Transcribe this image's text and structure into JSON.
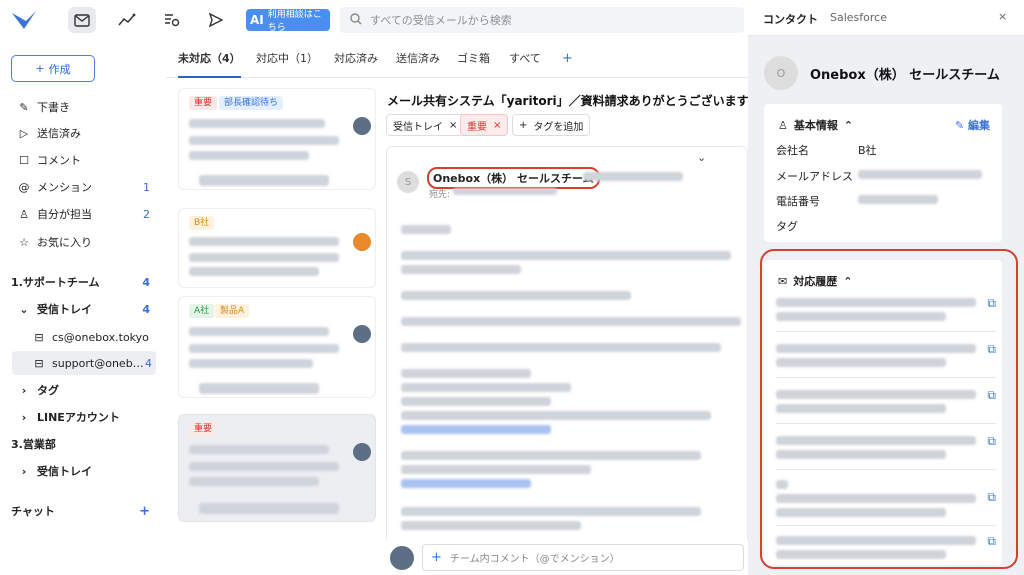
{
  "header": {
    "ai_badge": "AI",
    "ai_label": "利用相談はこちら",
    "search_placeholder": "すべての受信メールから検索"
  },
  "sidebar": {
    "compose_label": "作成",
    "items": [
      {
        "label": "下書き",
        "icon": "pencil-icon"
      },
      {
        "label": "送信済み",
        "icon": "send-icon"
      },
      {
        "label": "コメント",
        "icon": "comment-icon"
      },
      {
        "label": "メンション",
        "icon": "at-icon",
        "count": "1"
      },
      {
        "label": "自分が担当",
        "icon": "person-icon",
        "count": "2"
      },
      {
        "label": "お気に入り",
        "icon": "star-icon"
      }
    ],
    "team1": {
      "label": "1.サポートチーム",
      "count": "4"
    },
    "inbox": {
      "label": "受信トレイ",
      "count": "4"
    },
    "addr1": "cs@onebox.tokyo",
    "addr2": {
      "label": "support@oneb…",
      "count": "4"
    },
    "tag": "タグ",
    "line": "LINEアカウント",
    "team2": "3.営業部",
    "inbox2": "受信トレイ",
    "chat": "チャット",
    "chat_plus": "+"
  },
  "tabs": [
    {
      "label": "未対応（4）"
    },
    {
      "label": "対応中（1）"
    },
    {
      "label": "対応済み"
    },
    {
      "label": "送信済み"
    },
    {
      "label": "ゴミ箱"
    },
    {
      "label": "すべて"
    },
    {
      "label": "+"
    }
  ],
  "list": {
    "cards": [
      {
        "tags": [
          "重要",
          "部長確認待ち"
        ]
      },
      {
        "tags": [
          "B社"
        ]
      },
      {
        "tags": [
          "A社",
          "製品A"
        ]
      },
      {
        "tags": [
          "重要"
        ]
      }
    ]
  },
  "email": {
    "subject": "メール共有システム「yaritori」／資料請求ありがとうございます！",
    "chip_inbox": "受信トレイ",
    "chip_important": "重要",
    "chip_add": "タグを追加",
    "sender_initial": "S",
    "sender_name": "Onebox（株） セールスチーム",
    "to_label": "宛先:",
    "comment_placeholder": "チーム内コメント（@でメンション）"
  },
  "panel": {
    "tab_contact": "コンタクト",
    "tab_salesforce": "Salesforce",
    "close": "×",
    "contact_initial": "O",
    "contact_name": "Onebox（株） セールスチーム",
    "basic_title": "基本情報",
    "edit_label": "編集",
    "fields": {
      "company_label": "会社名",
      "company_value": "B社",
      "email_label": "メールアドレス",
      "phone_label": "電話番号",
      "tag_label": "タグ"
    },
    "history_title": "対応履歴"
  },
  "colors": {
    "accent": "#2c6ad9",
    "highlight_ring": "#d64030",
    "tag_red": "#d33333"
  }
}
